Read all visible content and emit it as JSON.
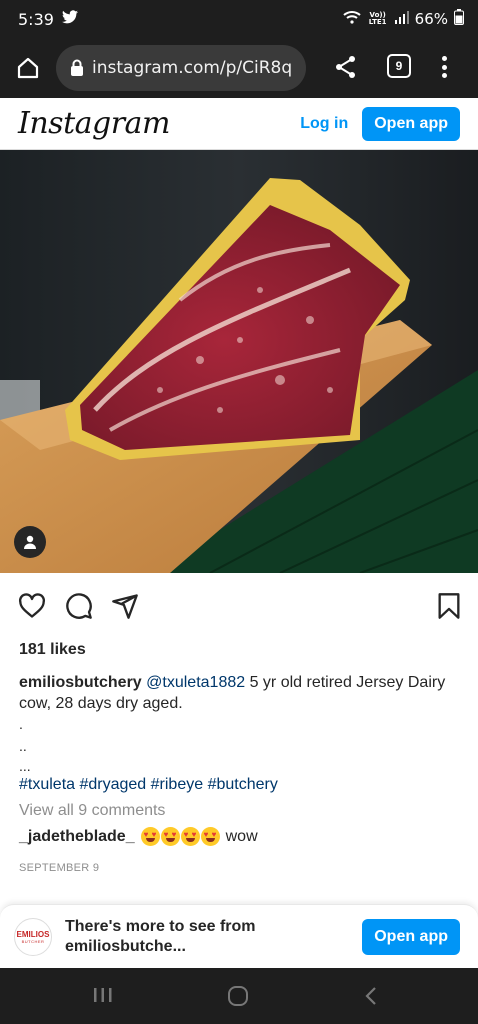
{
  "status_bar": {
    "time": "5:39",
    "network": "Vo)) LTE1",
    "battery": "66%"
  },
  "browser": {
    "url": "instagram.com/p/CiR8q",
    "tab_count": "9"
  },
  "header": {
    "logo": "Instagram",
    "login_label": "Log in",
    "open_app_label": "Open app"
  },
  "post": {
    "likes": "181 likes",
    "caption_user": "emiliosbutchery",
    "caption_mention": "@txuleta1882",
    "caption_text": " 5 yr old retired Jersey Dairy cow, 28 days dry aged.",
    "dots": [
      ".",
      "..",
      "..."
    ],
    "hashtags": "#txuleta #dryaged #ribeye #butchery",
    "view_comments": "View all 9 comments",
    "comment_user": "_jadetheblade_",
    "comment_text": "wow",
    "comment_emoji_count": 4,
    "date": "SEPTEMBER 9"
  },
  "banner": {
    "logo_text": "EMILIOS",
    "logo_subtext": "BUTCHER",
    "text": "There's more to see from emiliosbutche...",
    "open_app_label": "Open app"
  },
  "colors": {
    "accent": "#0095f6",
    "link": "#00376b",
    "muted": "#8e8e8e",
    "system_bar": "#1e1e1e"
  }
}
